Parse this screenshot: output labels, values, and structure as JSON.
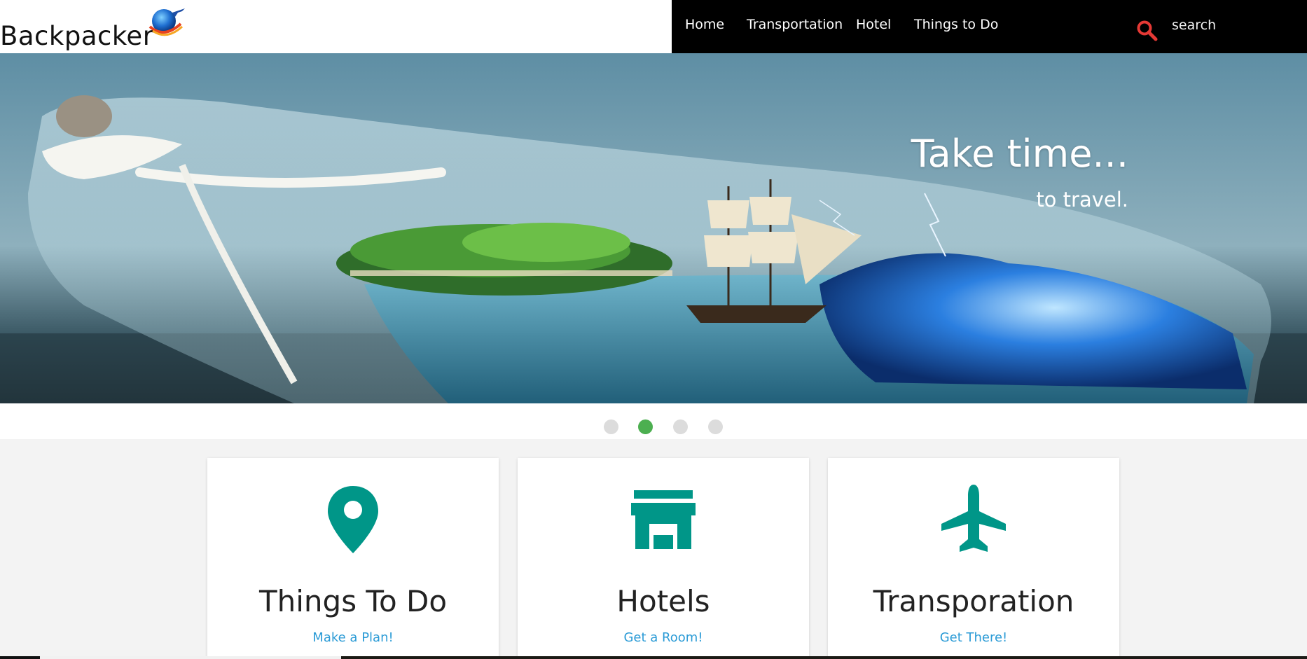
{
  "brand": {
    "name": "Backpacker",
    "logo_icon": "globe-plane-icon"
  },
  "nav": {
    "items": [
      {
        "label": "Home"
      },
      {
        "label": "Transportation"
      },
      {
        "label": "Hotel"
      },
      {
        "label": "Things to Do"
      }
    ],
    "search": {
      "placeholder": "search",
      "icon": "search-icon",
      "icon_color": "#e53935"
    }
  },
  "hero": {
    "title": "Take time...",
    "subtitle": "to travel.",
    "slides_total": 4,
    "active_slide": 2
  },
  "cards": [
    {
      "title": "Things To Do",
      "link": "Make a Plan!",
      "icon": "map-pin-icon"
    },
    {
      "title": "Hotels",
      "link": "Get a Room!",
      "icon": "store-icon"
    },
    {
      "title": "Transporation",
      "link": "Get There!",
      "icon": "airplane-icon"
    }
  ],
  "colors": {
    "accent": "#009688",
    "link": "#2b9bd6",
    "active_dot": "#4caf50",
    "nav_bg": "#000000"
  }
}
